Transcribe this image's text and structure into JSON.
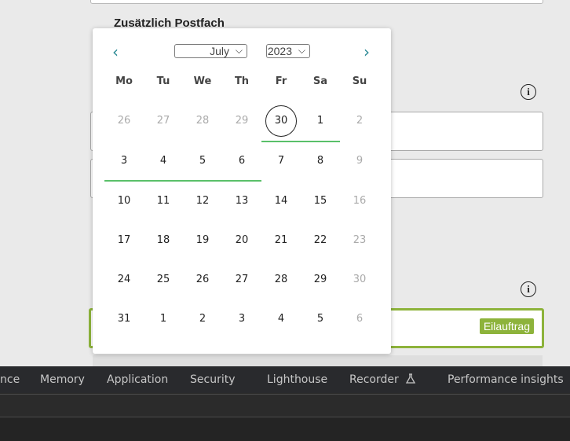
{
  "form": {
    "postfach_label": "Zusätzlich Postfach",
    "badge_label": "Eilauftrag"
  },
  "datepicker": {
    "prev_label": "‹",
    "next_label": "›",
    "month": "July",
    "year": "2023",
    "weekdays": [
      "Mo",
      "Tu",
      "We",
      "Th",
      "Fr",
      "Sa",
      "Su"
    ],
    "weeks": [
      [
        "26",
        "27",
        "28",
        "29",
        "30",
        "1",
        "2"
      ],
      [
        "3",
        "4",
        "5",
        "6",
        "7",
        "8",
        "9"
      ],
      [
        "10",
        "11",
        "12",
        "13",
        "14",
        "15",
        "16"
      ],
      [
        "17",
        "18",
        "19",
        "20",
        "21",
        "22",
        "23"
      ],
      [
        "24",
        "25",
        "26",
        "27",
        "28",
        "29",
        "30"
      ],
      [
        "31",
        "1",
        "2",
        "3",
        "4",
        "5",
        "6"
      ]
    ],
    "accent_color": "#2c8a95",
    "highlight_color": "#5ac06a"
  },
  "devtools": {
    "tabs": [
      "nce",
      "Memory",
      "Application",
      "Security",
      "Lighthouse",
      "Recorder",
      "Performance insights"
    ],
    "recorder_icon": "flask-icon"
  }
}
